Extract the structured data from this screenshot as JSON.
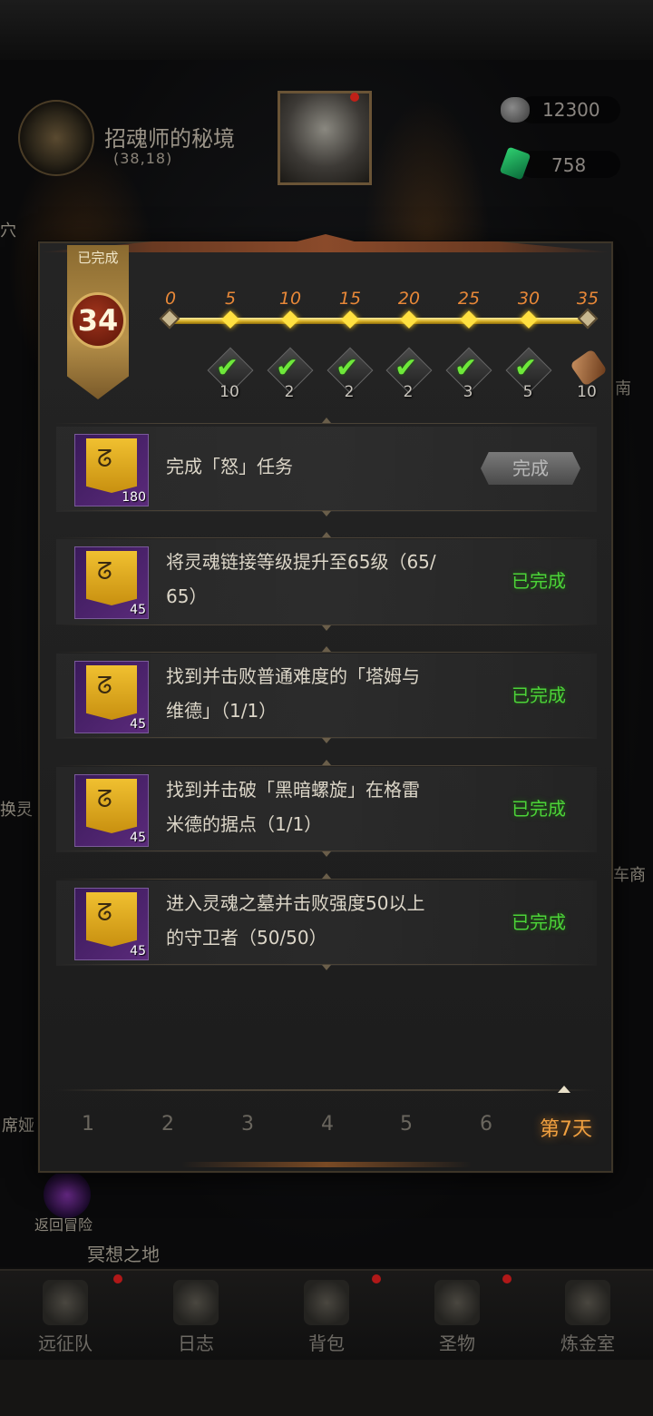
{
  "background": {
    "map_title": "招魂师的秘境",
    "map_coord": "(38,18)",
    "resources": [
      {
        "icon": "stone-icon",
        "value": "12300"
      },
      {
        "icon": "gem-icon",
        "value": "758"
      }
    ],
    "side_texts": {
      "left_top": "穴",
      "right_1": "南",
      "left_mid": "换灵",
      "right_mid": "车商",
      "left_bottom": "席娅",
      "return": "返回冒险",
      "meditation": "冥想之地"
    },
    "nav": [
      {
        "label": "远征队",
        "icon": "helmet-icon",
        "dot": true
      },
      {
        "label": "日志",
        "icon": "journal-icon",
        "dot": false
      },
      {
        "label": "背包",
        "icon": "bag-icon",
        "dot": true
      },
      {
        "label": "圣物",
        "icon": "relic-icon",
        "dot": true
      },
      {
        "label": "炼金室",
        "icon": "alchemy-icon",
        "dot": false
      }
    ]
  },
  "modal": {
    "banner_label": "已完成",
    "level": "34",
    "milestones": [
      "0",
      "5",
      "10",
      "15",
      "20",
      "25",
      "30",
      "35"
    ],
    "rewards": [
      {
        "count": "10",
        "claimed": true
      },
      {
        "count": "2",
        "claimed": true
      },
      {
        "count": "2",
        "claimed": true
      },
      {
        "count": "2",
        "claimed": true
      },
      {
        "count": "3",
        "claimed": true
      },
      {
        "count": "5",
        "claimed": true
      },
      {
        "count": "10",
        "claimed": false,
        "icon": "scroll-icon"
      }
    ],
    "tasks": [
      {
        "text_line1": "完成「怒」任务",
        "text_line2": "",
        "icon_count": "180",
        "status": "完成",
        "status_type": "button"
      },
      {
        "text_line1": "将灵魂链接等级提升至65级（65/",
        "text_line2": "65）",
        "icon_count": "45",
        "status": "已完成",
        "status_type": "done"
      },
      {
        "text_line1": "找到并击败普通难度的「塔姆与",
        "text_line2": "维德」（1/1）",
        "icon_count": "45",
        "status": "已完成",
        "status_type": "done"
      },
      {
        "text_line1": "找到并击破「黑暗螺旋」在格雷",
        "text_line2": "米德的据点（1/1）",
        "icon_count": "45",
        "status": "已完成",
        "status_type": "done"
      },
      {
        "text_line1": "进入灵魂之墓并击败强度50以上",
        "text_line2": "的守卫者（50/50）",
        "icon_count": "45",
        "status": "已完成",
        "status_type": "done"
      }
    ],
    "days": [
      "1",
      "2",
      "3",
      "4",
      "5",
      "6",
      "第7天"
    ],
    "active_day": "第7天"
  }
}
